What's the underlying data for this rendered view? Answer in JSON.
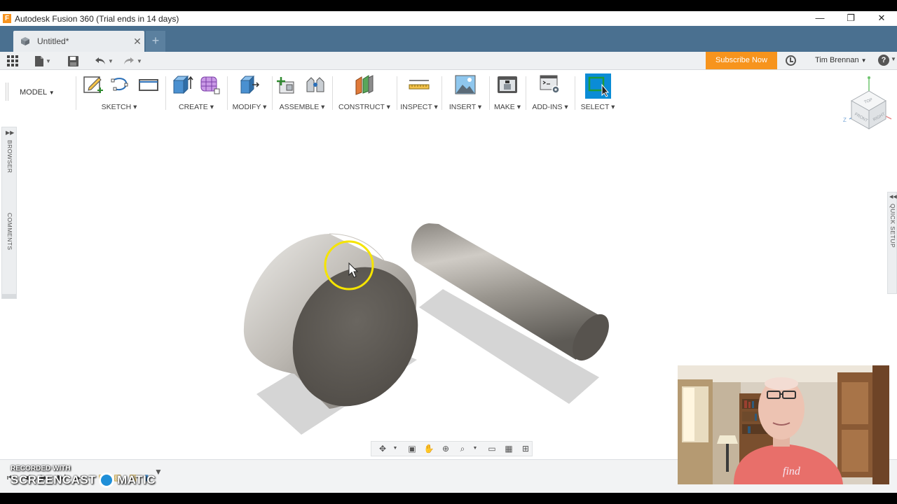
{
  "window": {
    "title": "Autodesk Fusion 360 (Trial ends in 14 days)",
    "logo_letter": "F",
    "minimize": "—",
    "restore": "❐",
    "close": "✕"
  },
  "tabs": {
    "document_tab": "Untitled*",
    "close": "✕",
    "new_tab": "+"
  },
  "quickbar": {
    "subscribe": "Subscribe Now",
    "user": "Tim Brennan",
    "help": "?"
  },
  "toolbar": {
    "workspace": "MODEL",
    "groups": {
      "sketch": "SKETCH",
      "create": "CREATE",
      "modify": "MODIFY",
      "assemble": "ASSEMBLE",
      "construct": "CONSTRUCT",
      "inspect": "INSPECT",
      "insert": "INSERT",
      "make": "MAKE",
      "addins": "ADD-INS",
      "select": "SELECT"
    }
  },
  "panels": {
    "browser": "BROWSER",
    "comments": "COMMENTS",
    "quick_setup": "QUICK SETUP"
  },
  "viewcube": {
    "top": "TOP",
    "front": "FRONT",
    "right": "RIGHT"
  },
  "watermark": {
    "recorded_with": "RECORDED WITH",
    "brand_left": "SCREENCAST",
    "brand_right": "MATIC"
  },
  "webcam": {
    "shirt_text": "find"
  },
  "accent_colors": {
    "tab_bar": "#4a7090",
    "subscribe": "#f7941d",
    "select_active": "#0a8cd6",
    "cursor_highlight": "#f5e400"
  }
}
